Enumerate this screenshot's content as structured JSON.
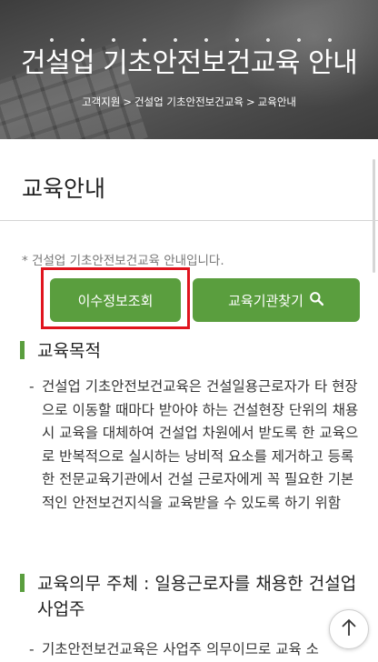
{
  "hero": {
    "title": "건설업 기초안전보건교육 안내",
    "breadcrumb": [
      "고객지원",
      "건설업 기초안전보건교육",
      "교육안내"
    ],
    "breadcrumb_separator": ">"
  },
  "page": {
    "title": "교육안내",
    "intro": "* 건설업 기초안전보건교육 안내입니다."
  },
  "buttons": {
    "history_label": "이수정보조회",
    "find_label": "교육기관찾기",
    "find_icon": "search-icon"
  },
  "sections": [
    {
      "heading": "교육목적",
      "bullets": [
        "건설업 기초안전보건교육은 건설일용근로자가 타 현장으로 이동할 때마다 받아야 하는 건설현장 단위의 채용시 교육을 대체하여 건설업 차원에서 받도록 한 교육으로 반복적으로 실시하는 낭비적 요소를 제거하고 등록한 전문교육기관에서 건설 근로자에게 꼭 필요한 기본적인 안전보건지식을 교육받을 수 있도록 하기 위함"
      ]
    },
    {
      "heading": "교육의무 주체 : 일용근로자를 채용한 건설업 사업주",
      "bullets": [
        "기초안전보건교육은 사업주 의무이므로 교육 소"
      ]
    }
  ],
  "colors": {
    "accent_green": "#5a9e3e",
    "highlight_red": "#e0141e"
  },
  "floating": {
    "top_icon": "arrow-up-icon"
  }
}
